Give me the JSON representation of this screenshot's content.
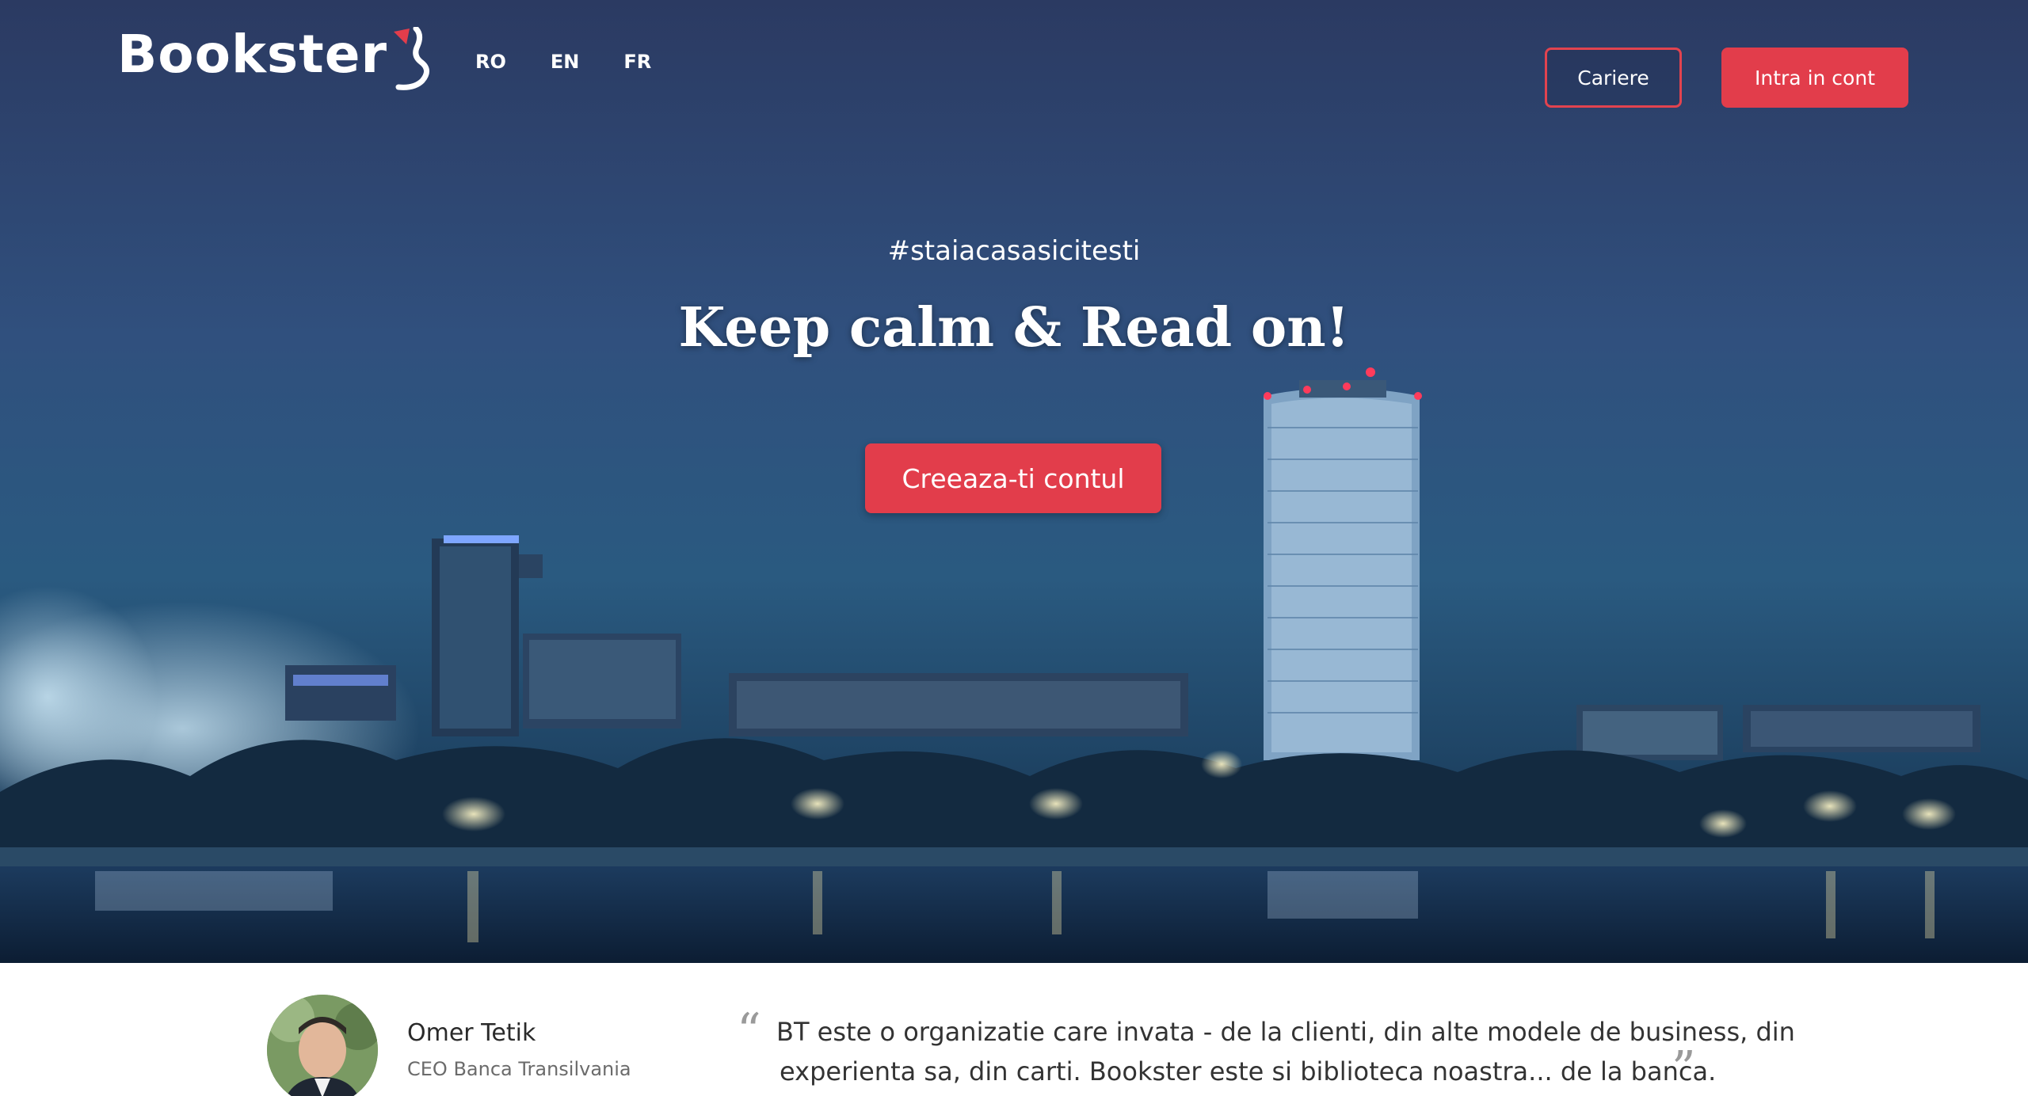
{
  "header": {
    "logo_text": "Bookster",
    "languages": [
      "RO",
      "EN",
      "FR"
    ],
    "careers_label": "Cariere",
    "login_label": "Intra in cont"
  },
  "hero": {
    "hashtag": "#staiacasasicitesti",
    "headline": "Keep calm & Read on!",
    "signup_label": "Creeaza-ti contul"
  },
  "testimonial": {
    "author_name": "Omer Tetik",
    "author_role": "CEO Banca Transilvania",
    "quote_open": "“",
    "quote_line_1": "BT este o organizatie care invata - de la clienti, din alte modele de business, din",
    "quote_line_2": "experienta sa, din carti. Bookster este si biblioteca noastra... de la banca.",
    "quote_close": "”"
  },
  "colors": {
    "accent": "#e23d4b",
    "sky_top": "#2a3c63",
    "water": "#0f2540"
  },
  "icons": {
    "logo_mark": "book-reader-icon"
  }
}
